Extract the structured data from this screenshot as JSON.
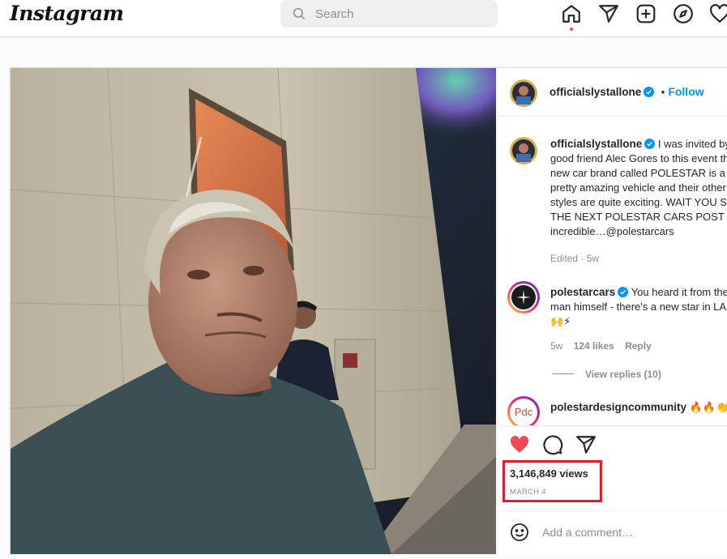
{
  "nav": {
    "logo": "Instagram",
    "search_placeholder": "Search",
    "icons": [
      "home-icon",
      "send-icon",
      "new-post-icon",
      "explore-icon",
      "activity-icon"
    ]
  },
  "post": {
    "author": "officialslystallone",
    "follow_label": "Follow",
    "caption": "I was invited by good friend Alec Gores to this event the new car brand called POLESTAR is a pretty amazing vehicle and their other styles are quite exciting. WAIT YOU SEE THE NEXT POLESTAR CARS POST … incredible…@polestarcars",
    "caption_meta": "Edited · 5w",
    "comments": [
      {
        "user": "polestarcars",
        "text": "You heard it from the man himself - there's a new star in LA 🙌⚡",
        "time": "5w",
        "likes": "124 likes",
        "reply_label": "Reply",
        "view_replies": "View replies (10)"
      },
      {
        "user": "polestardesigncommunity",
        "text": "🔥🔥👏",
        "avatar_text": "Pdc"
      }
    ],
    "views": "3,146,849 views",
    "date": "MARCH 4",
    "add_comment_placeholder": "Add a comment…"
  },
  "colors": {
    "accent": "#0095f6",
    "like_red": "#ed4956",
    "highlight_box": "#e21b25"
  }
}
